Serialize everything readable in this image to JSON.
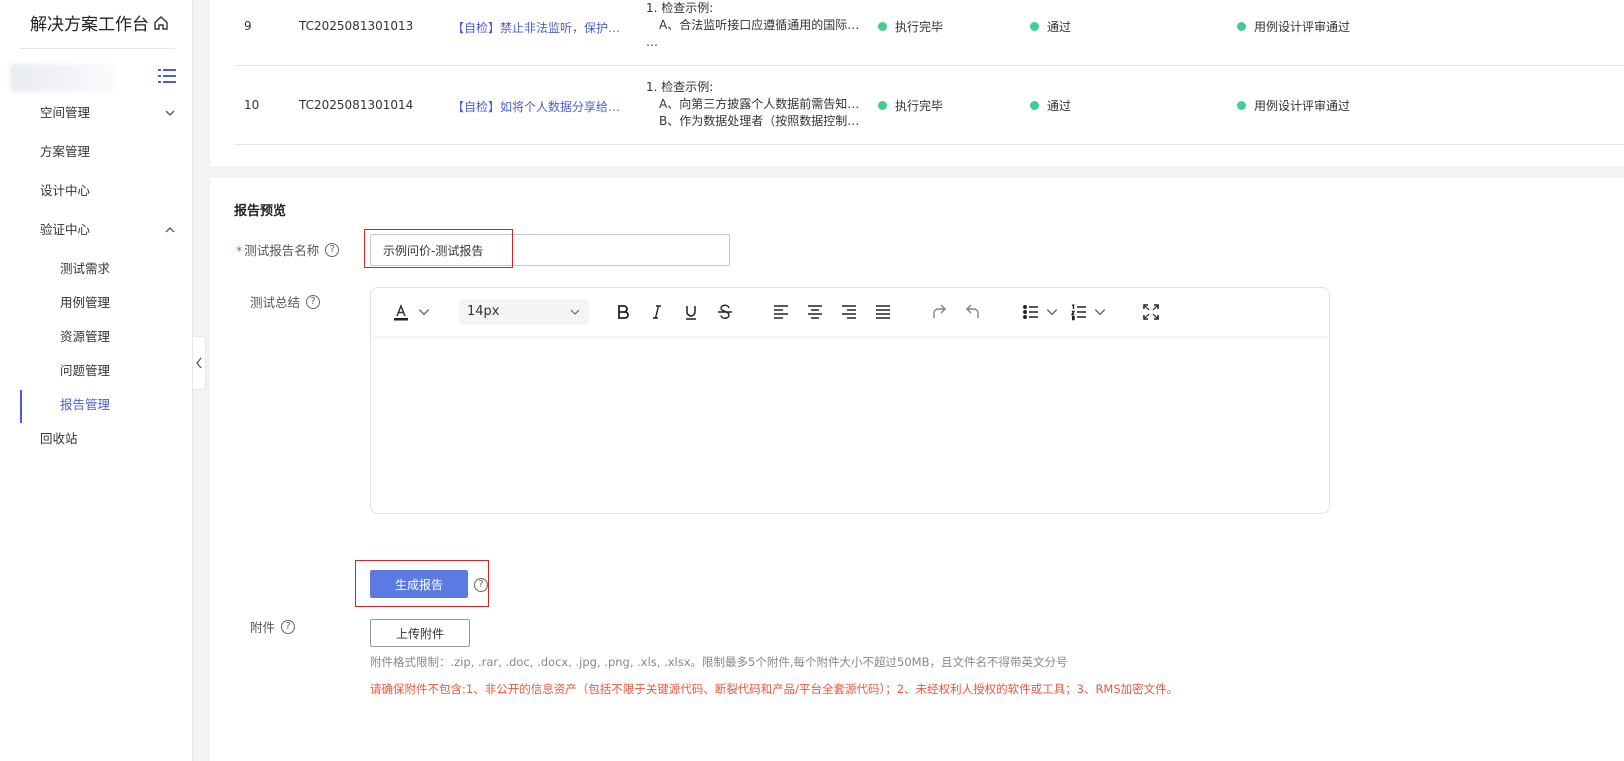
{
  "sidebar": {
    "title": "解决方案工作台",
    "items": [
      {
        "label": "空间管理"
      },
      {
        "label": "方案管理"
      },
      {
        "label": "设计中心"
      },
      {
        "label": "验证中心"
      },
      {
        "label": "回收站"
      }
    ],
    "sub_items": [
      {
        "label": "测试需求"
      },
      {
        "label": "用例管理"
      },
      {
        "label": "资源管理"
      },
      {
        "label": "问题管理"
      },
      {
        "label": "报告管理"
      }
    ]
  },
  "table": {
    "rows": [
      {
        "no": "9",
        "id": "TC2025081301013",
        "title": "【自检】禁止非法监听，保护…",
        "check": [
          "1. 检查示例:",
          "A、合法监听接口应遵循通用的国际…",
          "…"
        ],
        "exec_status": "执行完毕",
        "result": "通过",
        "review": "用例设计评审通过"
      },
      {
        "no": "10",
        "id": "TC2025081301014",
        "title": "【自检】如将个人数据分享给…",
        "check": [
          "1. 检查示例:",
          "A、向第三方披露个人数据前需告知…",
          "B、作为数据处理者（按照数据控制…"
        ],
        "exec_status": "执行完毕",
        "result": "通过",
        "review": "用例设计评审通过"
      }
    ]
  },
  "report": {
    "section_title": "报告预览",
    "name_label": "测试报告名称",
    "name_value": "示例问价-测试报告",
    "summary_label": "测试总结",
    "font_size": "14px",
    "generate_label": "生成报告",
    "attachment_label": "附件",
    "upload_label": "上传附件",
    "attachment_note": "附件格式限制：.zip, .rar, .doc, .docx, .jpg, .png, .xls, .xlsx。限制最多5个附件,每个附件大小不超过50MB，且文件名不得带英文分号",
    "attachment_warning": "请确保附件不包含:1、非公开的信息资产（包括不限于关键源代码、断裂代码和产品/平台全套源代码）；2、未经权利人授权的软件或工具；3、RMS加密文件。",
    "help_glyph": "?"
  },
  "colors": {
    "accent": "#4a5fd0",
    "button": "#5b7be3",
    "status_dot": "#3ecf8e",
    "warning": "#f0553b",
    "highlight_box": "#e02020"
  }
}
